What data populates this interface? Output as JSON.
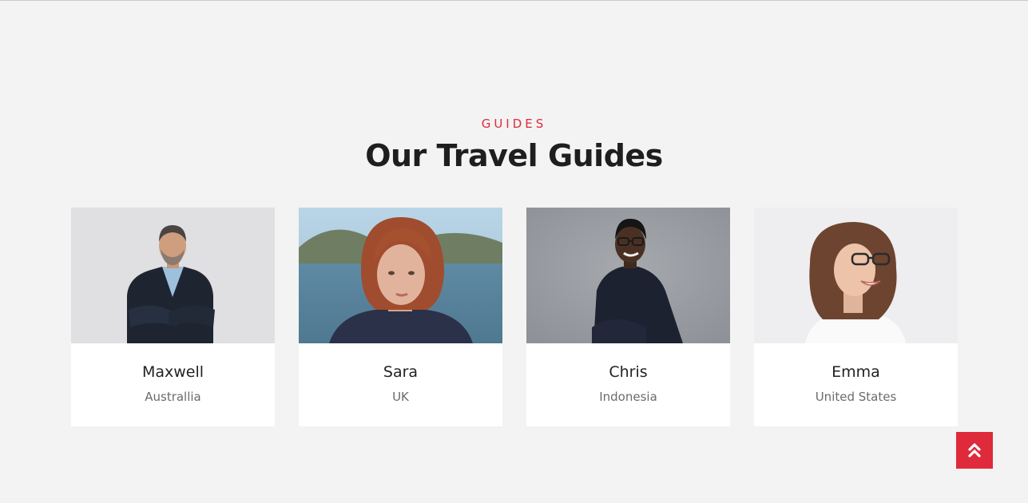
{
  "section": {
    "eyebrow": "GUIDES",
    "title": "Our Travel Guides"
  },
  "guides": [
    {
      "name": "Maxwell",
      "country": "Australlia",
      "photo": "man-in-suit-portrait"
    },
    {
      "name": "Sara",
      "country": "UK",
      "photo": "woman-lake-portrait"
    },
    {
      "name": "Chris",
      "country": "Indonesia",
      "photo": "man-with-glasses-portrait"
    },
    {
      "name": "Emma",
      "country": "United States",
      "photo": "woman-with-glasses-portrait"
    }
  ],
  "scroll_top": {
    "icon": "double-chevron-up-icon"
  },
  "colors": {
    "accent": "#df2a3b",
    "background": "#f3f3f3",
    "card": "#ffffff",
    "heading": "#1e1e1e",
    "muted": "#6b6b6b"
  }
}
